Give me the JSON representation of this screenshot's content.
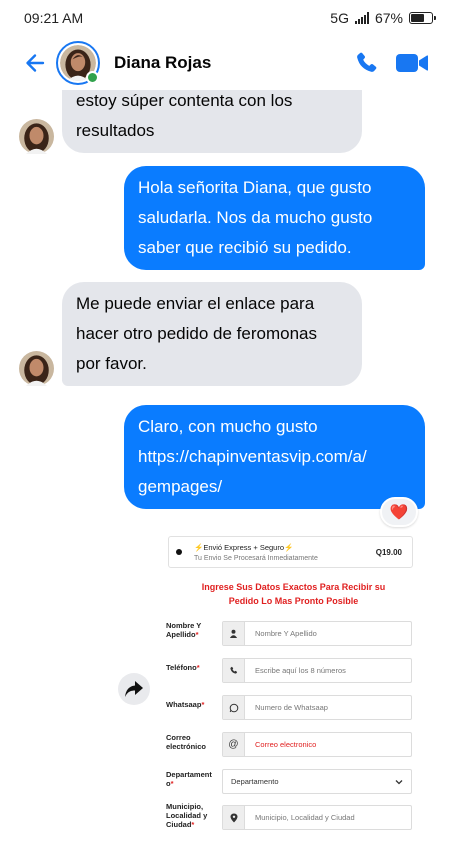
{
  "status_bar": {
    "time": "09:21 AM",
    "network": "5G",
    "battery": "67%",
    "battery_level": 0.67
  },
  "header": {
    "contact_name": "Diana Rojas",
    "back_icon": "arrow-left-icon",
    "call_icon": "phone-icon",
    "video_icon": "video-camera-icon",
    "online": true
  },
  "colors": {
    "accent": "#1877f2",
    "outgoing_bubble": "#0a7cff",
    "incoming_bubble": "#e4e6eb",
    "online": "#31a24c",
    "form_red": "#e02020"
  },
  "messages": [
    {
      "direction": "incoming",
      "lines": [
        "estoy súper contenta con los",
        "resultados"
      ]
    },
    {
      "direction": "outgoing",
      "lines": [
        "Hola señorita Diana, que gusto",
        "saludarla. Nos da mucho gusto",
        "saber que recibió su pedido."
      ]
    },
    {
      "direction": "incoming",
      "lines": [
        "Me puede enviar el enlace para",
        "hacer otro pedido de feromonas",
        "por favor."
      ]
    },
    {
      "direction": "outgoing",
      "lines": [
        "Claro, con mucho gusto",
        "https://chapinventasvip.com/a/",
        "gempages/"
      ],
      "reaction": "❤️"
    }
  ],
  "shared_image": {
    "shipping": {
      "title": "⚡Envió Express + Seguro⚡",
      "subtitle": "Tu Envio Se Procesará Inmediatamente",
      "price": "Q19.00"
    },
    "heading_lines": [
      "Ingrese Sus Datos Exactos Para Recibir su",
      "Pedido Lo Mas Pronto Posible"
    ],
    "fields": [
      {
        "label_lines": [
          "Nombre Y",
          "Apellido"
        ],
        "required": true,
        "icon": "user-icon",
        "placeholder": "Nombre Y Apellido"
      },
      {
        "label_lines": [
          "Teléfono"
        ],
        "required": true,
        "icon": "phone-icon",
        "placeholder": "Escribe aquí los 8 números"
      },
      {
        "label_lines": [
          "Whatsaap"
        ],
        "required": true,
        "icon": "whatsapp-icon",
        "placeholder": "Numero de Whatsaap"
      },
      {
        "label_lines": [
          "Correo",
          "electrónico"
        ],
        "required": false,
        "icon": "at-icon",
        "placeholder": "Correo electronico"
      },
      {
        "label_lines": [
          "Departament",
          "o"
        ],
        "required": true,
        "icon": "chevron-down-icon",
        "placeholder": "Departamento"
      },
      {
        "label_lines": [
          "Municipio,",
          "Localidad y",
          "Ciudad"
        ],
        "required": true,
        "icon": "location-pin-icon",
        "placeholder": "Municipio, Localidad y Ciudad"
      }
    ]
  },
  "forward_icon": "share-forward-icon"
}
